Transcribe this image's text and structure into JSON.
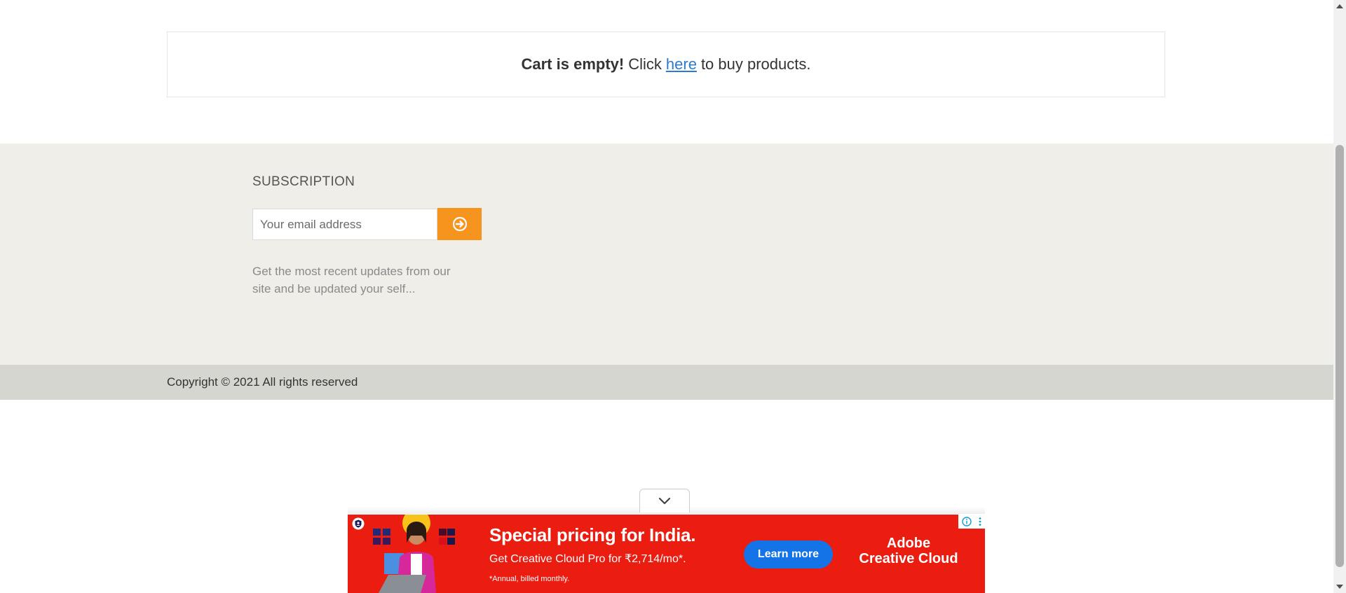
{
  "cart": {
    "bold": "Cart is empty!",
    "prefix": "Click",
    "link": "here",
    "suffix": "to buy products."
  },
  "subscription": {
    "title": "SUBSCRIPTION",
    "email_placeholder": "Your email address",
    "submit_icon": "arrow-circle-right-icon",
    "description": "Get the most recent updates from our site and be updated your self..."
  },
  "footer": {
    "copyright": "Copyright © 2021 All rights reserved"
  },
  "ad": {
    "headline": "Special pricing for India.",
    "subline": "Get Creative Cloud Pro for ₹2,714/mo*.",
    "note": "*Annual, billed monthly.",
    "cta": "Learn more",
    "brand_line1": "Adobe",
    "brand_line2": "Creative Cloud",
    "collapse_icon": "chevron-down-icon",
    "background": "#eb1c10",
    "cta_color": "#1473e6"
  },
  "colors": {
    "subscription_bg": "#efeee8",
    "footer_bg": "#d6d6d1",
    "button_orange": "#f7941d",
    "link_blue": "#2a7bd1"
  }
}
